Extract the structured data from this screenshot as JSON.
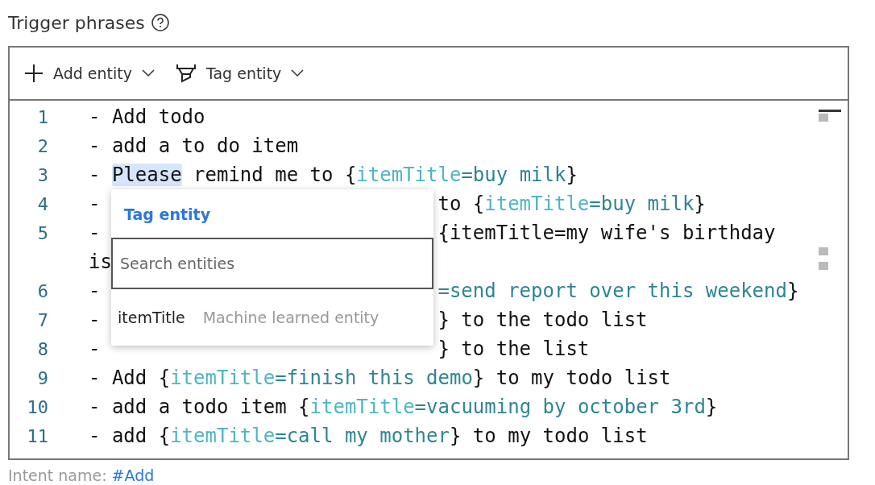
{
  "title": "Trigger phrases",
  "toolbar": [
    {
      "kind": "add",
      "label": "Add entity"
    },
    {
      "kind": "tag",
      "label": "Tag entity"
    }
  ],
  "lines": [
    {
      "number": "1",
      "segments": [
        {
          "kind": "text",
          "text": "- Add todo"
        }
      ]
    },
    {
      "number": "2",
      "segments": [
        {
          "kind": "text",
          "text": "- add a to do item"
        }
      ]
    },
    {
      "number": "3",
      "segments": [
        {
          "kind": "text",
          "text": "- "
        },
        {
          "kind": "selected",
          "text": "Please"
        },
        {
          "kind": "text",
          "text": " remind me to {"
        },
        {
          "kind": "name",
          "text": "itemTitle"
        },
        {
          "kind": "value",
          "text": "=buy milk"
        },
        {
          "kind": "text",
          "text": "}"
        }
      ]
    },
    {
      "number": "4",
      "segments": [
        {
          "kind": "text",
          "text": "-"
        }
      ],
      "tail": [
        {
          "kind": "text",
          "text": "to {"
        },
        {
          "kind": "name",
          "text": "itemTitle"
        },
        {
          "kind": "value",
          "text": "=buy milk"
        },
        {
          "kind": "text",
          "text": "}"
        }
      ]
    },
    {
      "number": "5",
      "segments": [
        {
          "kind": "text",
          "text": "-"
        }
      ],
      "tail": [
        {
          "kind": "text",
          "text": "{itemTitle=my wife's birthday"
        }
      ]
    },
    {
      "segments": [
        {
          "kind": "text",
          "text": "is"
        }
      ]
    },
    {
      "number": "6",
      "segments": [
        {
          "kind": "text",
          "text": "-"
        }
      ],
      "tail": [
        {
          "kind": "value",
          "text": "=send report over this weekend"
        },
        {
          "kind": "text",
          "text": "}"
        }
      ]
    },
    {
      "number": "7",
      "segments": [
        {
          "kind": "text",
          "text": "-"
        }
      ],
      "tail": [
        {
          "kind": "text",
          "text": "} to the todo list"
        }
      ]
    },
    {
      "number": "8",
      "segments": [
        {
          "kind": "text",
          "text": "-"
        }
      ],
      "tail": [
        {
          "kind": "text",
          "text": "} to the list"
        }
      ]
    },
    {
      "number": "9",
      "segments": [
        {
          "kind": "text",
          "text": "- Add {"
        },
        {
          "kind": "name",
          "text": "itemTitle"
        },
        {
          "kind": "value",
          "text": "=finish this demo"
        },
        {
          "kind": "text",
          "text": "} to my todo list"
        }
      ]
    },
    {
      "number": "10",
      "segments": [
        {
          "kind": "text",
          "text": "- add a todo item {"
        },
        {
          "kind": "name",
          "text": "itemTitle"
        },
        {
          "kind": "value",
          "text": "=vacuuming by october 3rd"
        },
        {
          "kind": "text",
          "text": "}"
        }
      ]
    },
    {
      "number": "11",
      "segments": [
        {
          "kind": "text",
          "text": "- add {"
        },
        {
          "kind": "name",
          "text": "itemTitle"
        },
        {
          "kind": "value",
          "text": "=call my mother"
        },
        {
          "kind": "text",
          "text": "} to my todo list"
        }
      ]
    }
  ],
  "popup": {
    "title": "Tag entity",
    "search": {
      "placeholder": "Search entities"
    },
    "items": [
      {
        "name": "itemTitle",
        "type": "Machine learned entity"
      }
    ]
  },
  "footer": {
    "label": "Intent name:",
    "link": "#Add"
  }
}
